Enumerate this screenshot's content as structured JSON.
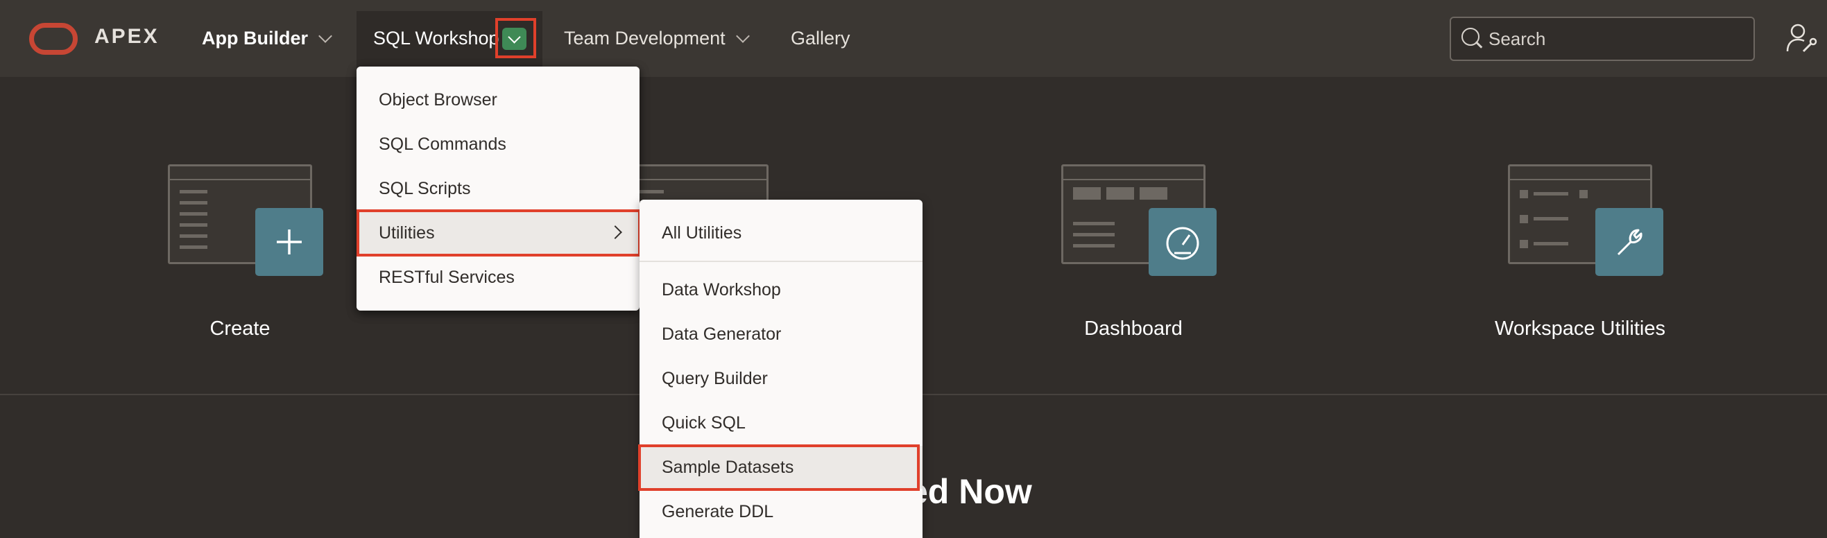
{
  "brand": {
    "logo_text": "APEX",
    "accent": "#c74634"
  },
  "nav": {
    "app_builder": "App Builder",
    "sql_workshop": "SQL Workshop",
    "team_development": "Team Development",
    "gallery": "Gallery"
  },
  "search": {
    "placeholder": "Search"
  },
  "tiles": [
    {
      "label": "Create",
      "icon": "plus-icon"
    },
    {
      "label": "",
      "icon": ""
    },
    {
      "label": "Dashboard",
      "icon": "gauge-icon"
    },
    {
      "label": "Workspace Utilities",
      "icon": "wrench-icon"
    }
  ],
  "section_heading_partial": "ed Now",
  "sql_workshop_menu": {
    "items": [
      "Object Browser",
      "SQL Commands",
      "SQL Scripts",
      "Utilities",
      "RESTful Services"
    ],
    "selected": "Utilities"
  },
  "utilities_submenu": {
    "items": [
      "All Utilities",
      "Data Workshop",
      "Data Generator",
      "Query Builder",
      "Quick SQL",
      "Sample Datasets",
      "Generate DDL"
    ],
    "selected": "Sample Datasets"
  },
  "colors": {
    "highlight_border": "#e0402b",
    "toggle_green": "#3f8a56",
    "tile_badge": "#4f7d8a"
  }
}
